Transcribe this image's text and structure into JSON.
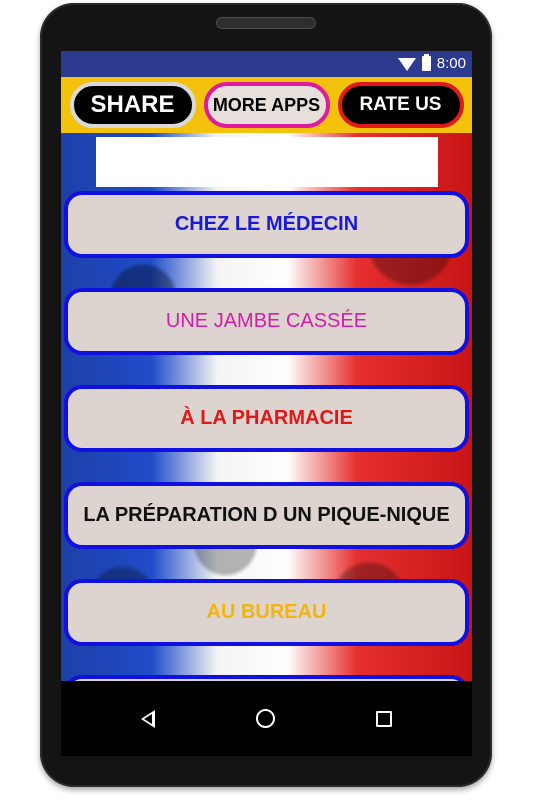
{
  "statusbar": {
    "time": "8:00"
  },
  "topbar": {
    "share_label": "SHARE",
    "more_apps_label": "MORE APPS",
    "rate_us_label": "RATE US"
  },
  "menu": {
    "items": [
      {
        "label": "CHEZ LE MÉDECIN",
        "color": "#1a1ad6",
        "bold": true
      },
      {
        "label": "UNE JAMBE CASSÉE",
        "color": "#d61ca8",
        "bold": false
      },
      {
        "label": "À LA PHARMACIE",
        "color": "#e01818",
        "bold": true
      },
      {
        "label": "LA PRÉPARATION D UN PIQUE-NIQUE",
        "color": "#111111",
        "bold": true
      },
      {
        "label": "AU BUREAU",
        "color": "#f2b50c",
        "bold": true
      }
    ]
  },
  "navbar": {
    "icons": [
      "back-icon",
      "home-icon",
      "recents-icon"
    ]
  }
}
